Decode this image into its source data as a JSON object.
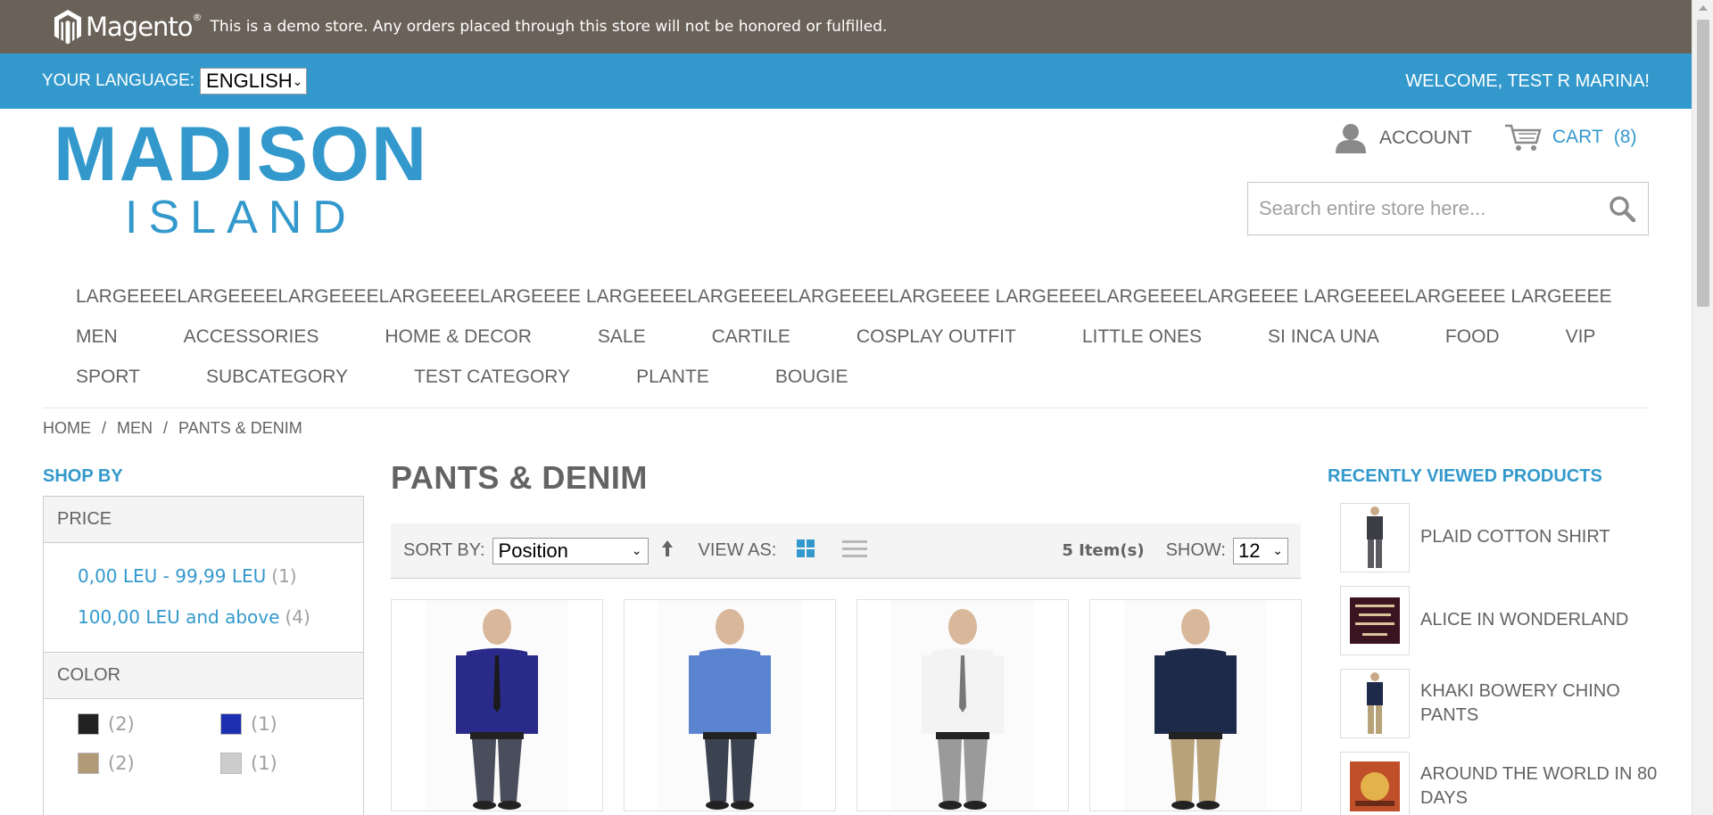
{
  "demo_bar": {
    "logo_text": "Magento",
    "logo_mark": "®",
    "notice": "This is a demo store. Any orders placed through this store will not be honored or fulfilled."
  },
  "lang_bar": {
    "label": "YOUR LANGUAGE:",
    "selected": "English",
    "welcome": "WELCOME, TEST R MARINA!"
  },
  "header": {
    "logo_line1": "MADISON",
    "logo_line2": "ISLAND",
    "account_label": "ACCOUNT",
    "cart_label": "CART",
    "cart_count": "(8)",
    "search_placeholder": "Search entire store here..."
  },
  "nav": {
    "rows": [
      [
        "LARGEEEELARGEEEELARGEEEELARGEEEELARGEEEE LARGEEEELARGEEEELARGEEEELARGEEEE LARGEEEELARGEEEELARGEEEE LARGEEEELARGEEEE LARGEEEE"
      ],
      [
        "MEN",
        "ACCESSORIES",
        "HOME & DECOR",
        "SALE",
        "CARTILE",
        "COSPLAY OUTFIT",
        "LITTLE ONES",
        "SI INCA UNA",
        "FOOD",
        "VIP"
      ],
      [
        "SPORT",
        "SUBCATEGORY",
        "TEST CATEGORY",
        "PLANTE",
        "BOUGIE"
      ]
    ]
  },
  "breadcrumb": {
    "items": [
      "HOME",
      "MEN",
      "PANTS & DENIM"
    ],
    "separator": "/"
  },
  "sidebar": {
    "title": "SHOP BY",
    "price": {
      "heading": "PRICE",
      "options": [
        {
          "label": "0,00 LEU - 99,99 LEU",
          "count": "(1)"
        },
        {
          "label": "100,00 LEU and above",
          "count": "(4)"
        }
      ]
    },
    "color": {
      "heading": "COLOR",
      "swatches": [
        {
          "color": "#222222",
          "count": "(2)"
        },
        {
          "color": "#1b2fb0",
          "count": "(1)"
        },
        {
          "color": "#b09a78",
          "count": "(2)"
        },
        {
          "color": "#cccccc",
          "count": "(1)"
        }
      ]
    }
  },
  "main": {
    "title": "PANTS & DENIM",
    "toolbar": {
      "sort_label": "SORT BY:",
      "sort_value": "Position",
      "view_label": "VIEW AS:",
      "items": "5 Item(s)",
      "show_label": "SHOW:",
      "show_value": "12"
    },
    "products": [
      {
        "shirt": "#2a2a8a",
        "pants": "#4a4e5c",
        "tie": "#1a1a1a"
      },
      {
        "shirt": "#5a84d0",
        "pants": "#3b4250",
        "tie": ""
      },
      {
        "shirt": "#f3f3f3",
        "pants": "#9a9a9a",
        "tie": "#777777"
      },
      {
        "shirt": "#1e2a4a",
        "pants": "#b8a27a",
        "tie": ""
      }
    ]
  },
  "recently_viewed": {
    "title": "RECENTLY VIEWED PRODUCTS",
    "items": [
      {
        "name": "PLAID COTTON SHIRT"
      },
      {
        "name": "ALICE IN WONDERLAND"
      },
      {
        "name": "KHAKI BOWERY CHINO PANTS"
      },
      {
        "name": "AROUND THE WORLD IN 80 DAYS"
      }
    ]
  },
  "colors": {
    "accent": "#3399cc",
    "demo_bar": "#6a6258",
    "text": "#636363"
  }
}
